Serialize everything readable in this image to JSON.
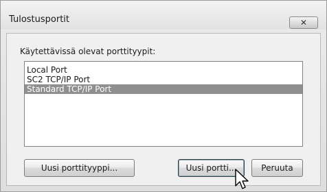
{
  "window": {
    "title": "Tulostusportit",
    "close_label": "✕"
  },
  "list": {
    "label": "Käytettävissä olevat porttityypit:",
    "items": [
      {
        "label": "Local Port",
        "selected": false
      },
      {
        "label": "SC2 TCP/IP Port",
        "selected": false
      },
      {
        "label": "Standard TCP/IP Port",
        "selected": true
      }
    ]
  },
  "buttons": {
    "new_port_type": "Uusi porttityyppi...",
    "new_port": "Uusi portti...",
    "cancel": "Peruuta"
  },
  "colors": {
    "selection": "#8f8f8f",
    "background": "#f0f0f0"
  },
  "icons": {
    "close": "close-icon",
    "cursor": "mouse-pointer-icon"
  }
}
